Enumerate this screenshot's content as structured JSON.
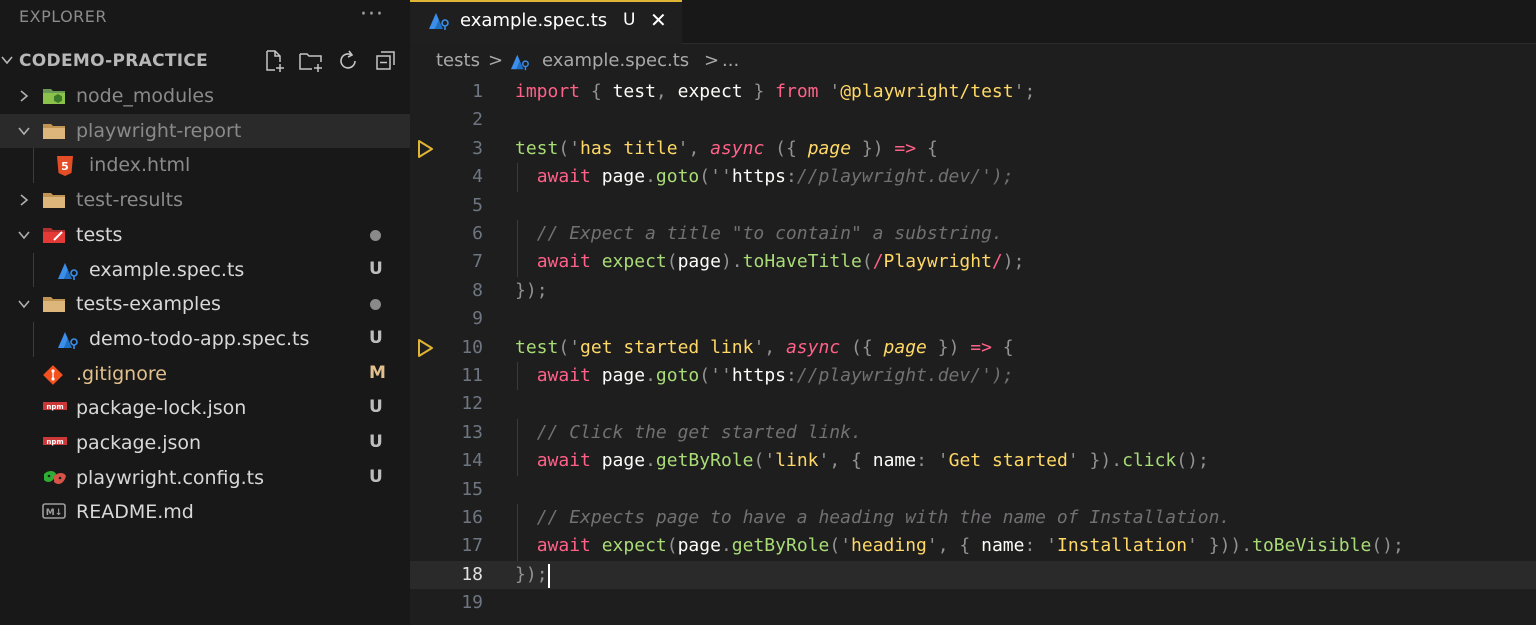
{
  "explorer": {
    "header": "EXPLORER",
    "more": "···",
    "project": "CODEMO-PRACTICE",
    "tree": [
      {
        "label": "node_modules",
        "kind": "folder-node",
        "state": "collapsed",
        "color": "#8a8a8a"
      },
      {
        "label": "playwright-report",
        "kind": "folder",
        "state": "expanded",
        "color": "#8a8a8a",
        "selected": true
      },
      {
        "label": "index.html",
        "kind": "html",
        "color": "#8a8a8a"
      },
      {
        "label": "test-results",
        "kind": "folder",
        "state": "collapsed",
        "color": "#8a8a8a"
      },
      {
        "label": "tests",
        "kind": "folder-tests",
        "state": "expanded",
        "color": "#d8d8d8",
        "dot": true
      },
      {
        "label": "example.spec.ts",
        "kind": "spec",
        "color": "#d8d8d8",
        "badge": "U"
      },
      {
        "label": "tests-examples",
        "kind": "folder",
        "state": "expanded",
        "color": "#d8d8d8",
        "dot": true
      },
      {
        "label": "demo-todo-app.spec.ts",
        "kind": "spec",
        "color": "#d8d8d8",
        "badge": "U"
      },
      {
        "label": ".gitignore",
        "kind": "git",
        "color": "#e2c08d",
        "badge": "M"
      },
      {
        "label": "package-lock.json",
        "kind": "npm",
        "color": "#d8d8d8",
        "badge": "U"
      },
      {
        "label": "package.json",
        "kind": "npm",
        "color": "#d8d8d8",
        "badge": "U"
      },
      {
        "label": "playwright.config.ts",
        "kind": "playwright",
        "color": "#d8d8d8",
        "badge": "U"
      },
      {
        "label": "README.md",
        "kind": "markdown",
        "color": "#d8d8d8"
      }
    ]
  },
  "tab": {
    "title": "example.spec.ts",
    "status": "U",
    "close": "✕"
  },
  "breadcrumb": {
    "folder": "tests",
    "file": "example.spec.ts",
    "sep": ">",
    "more": "..."
  },
  "editor": {
    "current_line": 18,
    "lines": [
      "import { test, expect } from '@playwright/test';",
      "",
      "test('has title', async ({ page }) => {",
      "  await page.goto('https://playwright.dev/');",
      "",
      "  // Expect a title \"to contain\" a substring.",
      "  await expect(page).toHaveTitle(/Playwright/);",
      "});",
      "",
      "test('get started link', async ({ page }) => {",
      "  await page.goto('https://playwright.dev/');",
      "",
      "  // Click the get started link.",
      "  await page.getByRole('link', { name: 'Get started' }).click();",
      "",
      "  // Expects page to have a heading with the name of Installation.",
      "  await expect(page.getByRole('heading', { name: 'Installation' })).toBeVisible();",
      "});",
      ""
    ],
    "run_markers": [
      3,
      10
    ]
  },
  "colors": {
    "accent": "#e0b434",
    "sidebar_bg": "#181818",
    "editor_bg": "#1e1e1e"
  }
}
